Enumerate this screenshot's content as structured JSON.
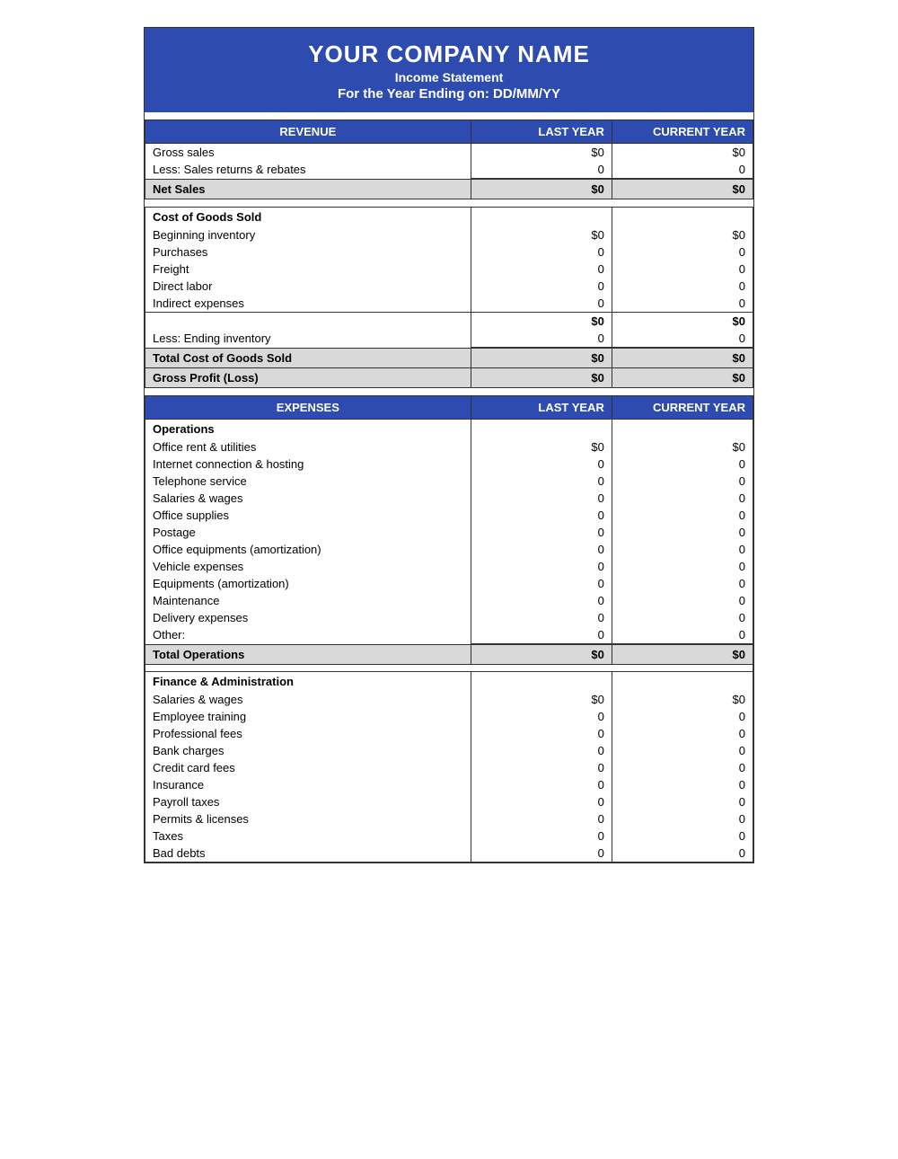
{
  "header": {
    "company_name": "YOUR COMPANY NAME",
    "subtitle": "Income Statement",
    "date_line": "For the Year Ending on: DD/MM/YY"
  },
  "revenue_section": {
    "title": "REVENUE",
    "col_last_year": "LAST YEAR",
    "col_current_year": "CURRENT YEAR",
    "rows": [
      {
        "label": "Gross sales",
        "last_year": "$0",
        "current_year": "$0"
      },
      {
        "label": "Less: Sales returns & rebates",
        "last_year": "0",
        "current_year": "0"
      }
    ],
    "net_sales": {
      "label": "Net Sales",
      "last_year": "$0",
      "current_year": "$0"
    }
  },
  "cogs_section": {
    "title": "Cost of Goods Sold",
    "rows": [
      {
        "label": "Beginning inventory",
        "last_year": "$0",
        "current_year": "$0"
      },
      {
        "label": "Purchases",
        "last_year": "0",
        "current_year": "0"
      },
      {
        "label": "Freight",
        "last_year": "0",
        "current_year": "0"
      },
      {
        "label": "Direct labor",
        "last_year": "0",
        "current_year": "0"
      },
      {
        "label": "Indirect expenses",
        "last_year": "0",
        "current_year": "0"
      }
    ],
    "subtotal": {
      "last_year": "$0",
      "current_year": "$0"
    },
    "ending_inventory": {
      "label": "Less: Ending inventory",
      "last_year": "0",
      "current_year": "0"
    },
    "total_cogs": {
      "label": "Total Cost of Goods Sold",
      "last_year": "$0",
      "current_year": "$0"
    },
    "gross_profit": {
      "label": "Gross Profit (Loss)",
      "last_year": "$0",
      "current_year": "$0"
    }
  },
  "expenses_section": {
    "title": "EXPENSES",
    "col_last_year": "LAST YEAR",
    "col_current_year": "CURRENT YEAR",
    "operations_label": "Operations",
    "operations_rows": [
      {
        "label": "Office rent & utilities",
        "last_year": "$0",
        "current_year": "$0"
      },
      {
        "label": "Internet connection & hosting",
        "last_year": "0",
        "current_year": "0"
      },
      {
        "label": "Telephone service",
        "last_year": "0",
        "current_year": "0"
      },
      {
        "label": "Salaries & wages",
        "last_year": "0",
        "current_year": "0"
      },
      {
        "label": "Office supplies",
        "last_year": "0",
        "current_year": "0"
      },
      {
        "label": "Postage",
        "last_year": "0",
        "current_year": "0"
      },
      {
        "label": "Office equipments (amortization)",
        "last_year": "0",
        "current_year": "0"
      },
      {
        "label": "Vehicle expenses",
        "last_year": "0",
        "current_year": "0"
      },
      {
        "label": "Equipments (amortization)",
        "last_year": "0",
        "current_year": "0"
      },
      {
        "label": "Maintenance",
        "last_year": "0",
        "current_year": "0"
      },
      {
        "label": "Delivery expenses",
        "last_year": "0",
        "current_year": "0"
      },
      {
        "label": "Other:",
        "last_year": "0",
        "current_year": "0"
      }
    ],
    "total_operations": {
      "label": "Total Operations",
      "last_year": "$0",
      "current_year": "$0"
    },
    "finance_label": "Finance & Administration",
    "finance_rows": [
      {
        "label": "Salaries & wages",
        "last_year": "$0",
        "current_year": "$0"
      },
      {
        "label": "Employee training",
        "last_year": "0",
        "current_year": "0"
      },
      {
        "label": "Professional fees",
        "last_year": "0",
        "current_year": "0"
      },
      {
        "label": "Bank charges",
        "last_year": "0",
        "current_year": "0"
      },
      {
        "label": "Credit card fees",
        "last_year": "0",
        "current_year": "0"
      },
      {
        "label": "Insurance",
        "last_year": "0",
        "current_year": "0"
      },
      {
        "label": "Payroll taxes",
        "last_year": "0",
        "current_year": "0"
      },
      {
        "label": "Permits & licenses",
        "last_year": "0",
        "current_year": "0"
      },
      {
        "label": "Taxes",
        "last_year": "0",
        "current_year": "0"
      },
      {
        "label": "Bad debts",
        "last_year": "0",
        "current_year": "0"
      }
    ]
  }
}
